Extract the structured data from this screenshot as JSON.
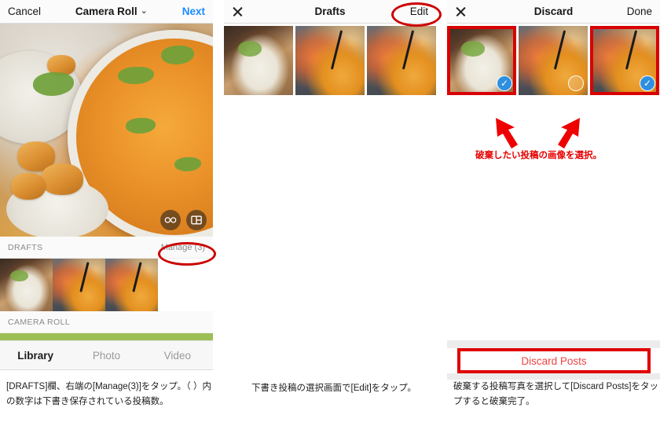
{
  "left_panel": {
    "nav": {
      "cancel_label": "Cancel",
      "title": "Camera Roll",
      "chevron": "⌄",
      "next_label": "Next"
    },
    "badges": {
      "boomerang_icon": "infinity-icon",
      "layout_icon": "layout-grid-icon"
    },
    "drafts_section": {
      "label": "DRAFTS",
      "action_label": "Manage (3)"
    },
    "camera_roll_section": {
      "label": "CAMERA ROLL"
    },
    "tabs": [
      {
        "label": "Library",
        "active": true
      },
      {
        "label": "Photo",
        "active": false
      },
      {
        "label": "Video",
        "active": false
      }
    ],
    "caption": "[DRAFTS]欄、右端の[Manage(3)]をタップ。（ ）内の数字は下書き保存されている投稿数。"
  },
  "mid_panel": {
    "nav": {
      "close_icon": "close-x-icon",
      "title": "Drafts",
      "edit_label": "Edit"
    },
    "caption": "下書き投稿の選択画面で[Edit]をタップ。"
  },
  "right_panel": {
    "nav": {
      "close_icon": "close-x-icon",
      "title": "Discard",
      "done_label": "Done"
    },
    "cells": [
      {
        "selected": true,
        "check": "on",
        "check_glyph": "✓"
      },
      {
        "selected": false,
        "check": "off",
        "check_glyph": ""
      },
      {
        "selected": true,
        "check": "on",
        "check_glyph": "✓"
      }
    ],
    "annotation_text": "破棄したい投稿の画像を選択。",
    "discard_button_label": "Discard Posts",
    "caption": "破棄する投稿写真を選択して[Discard Posts]をタップすると破棄完了。"
  },
  "colors": {
    "accent_red": "#cc0000",
    "blue_link": "#1a8cff",
    "green_bar": "#9cbf55",
    "check_blue": "#2f8fe0",
    "discard_text": "#ef4343"
  }
}
